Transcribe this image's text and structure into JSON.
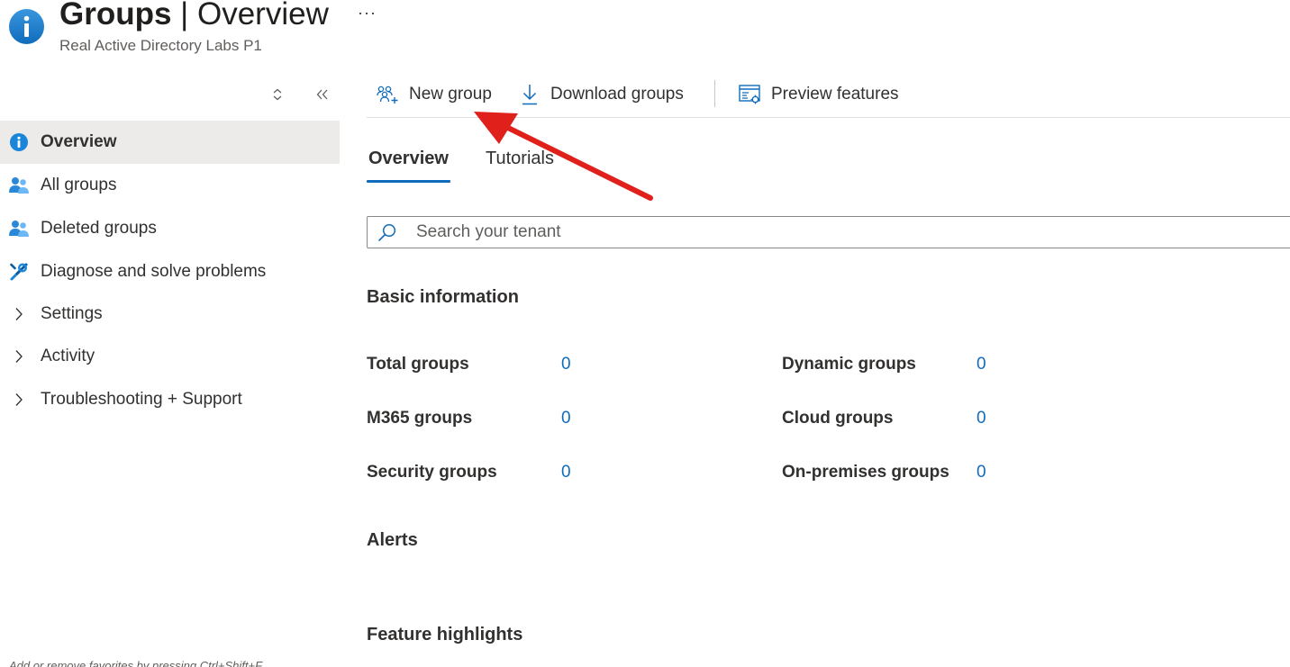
{
  "header": {
    "title_bold": "Groups",
    "title_rest": " | Overview",
    "subtitle": "Real Active Directory Labs P1",
    "more": "···",
    "icon": "info-icon"
  },
  "sidebar": {
    "items": [
      {
        "label": "Overview",
        "icon": "info-icon",
        "active": true
      },
      {
        "label": "All groups",
        "icon": "group-icon"
      },
      {
        "label": "Deleted groups",
        "icon": "group-icon"
      },
      {
        "label": "Diagnose and solve problems",
        "icon": "wrench-icon"
      },
      {
        "label": "Settings",
        "icon": "chevron-right-icon"
      },
      {
        "label": "Activity",
        "icon": "chevron-right-icon"
      },
      {
        "label": "Troubleshooting + Support",
        "icon": "chevron-right-icon"
      }
    ],
    "footnote": "Add or remove favorites by pressing Ctrl+Shift+F"
  },
  "toolbar": {
    "new_group": "New group",
    "download_groups": "Download groups",
    "preview_features": "Preview features"
  },
  "tabs": [
    "Overview",
    "Tutorials"
  ],
  "search": {
    "placeholder": "Search your tenant"
  },
  "sections": {
    "basic_information": "Basic information",
    "alerts": "Alerts",
    "feature_highlights": "Feature highlights"
  },
  "stats": [
    {
      "label": "Total groups",
      "value": "0"
    },
    {
      "label": "M365 groups",
      "value": "0"
    },
    {
      "label": "Security groups",
      "value": "0"
    },
    {
      "label": "Dynamic groups",
      "value": "0"
    },
    {
      "label": "Cloud groups",
      "value": "0"
    },
    {
      "label": "On-premises groups",
      "value": "0"
    }
  ],
  "colors": {
    "accent": "#0f6cbd",
    "annotation_arrow": "#e0201b",
    "active_nav_bg": "#edebe9"
  }
}
